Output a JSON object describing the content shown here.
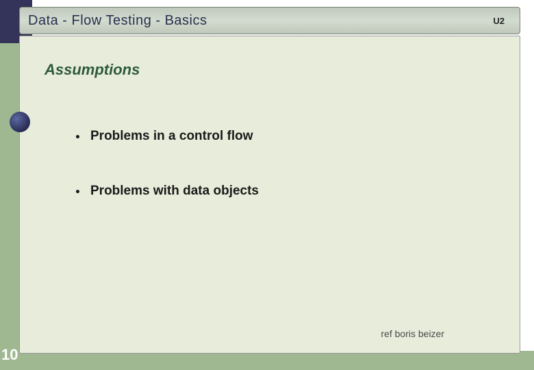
{
  "header": {
    "title": "Data - Flow Testing   -  Basics",
    "tag": "U2"
  },
  "content": {
    "section_title": "Assumptions",
    "bullets": [
      "Problems in a control flow",
      "Problems with data objects"
    ]
  },
  "footer": {
    "slide_number": "10",
    "reference": "ref boris beizer"
  }
}
